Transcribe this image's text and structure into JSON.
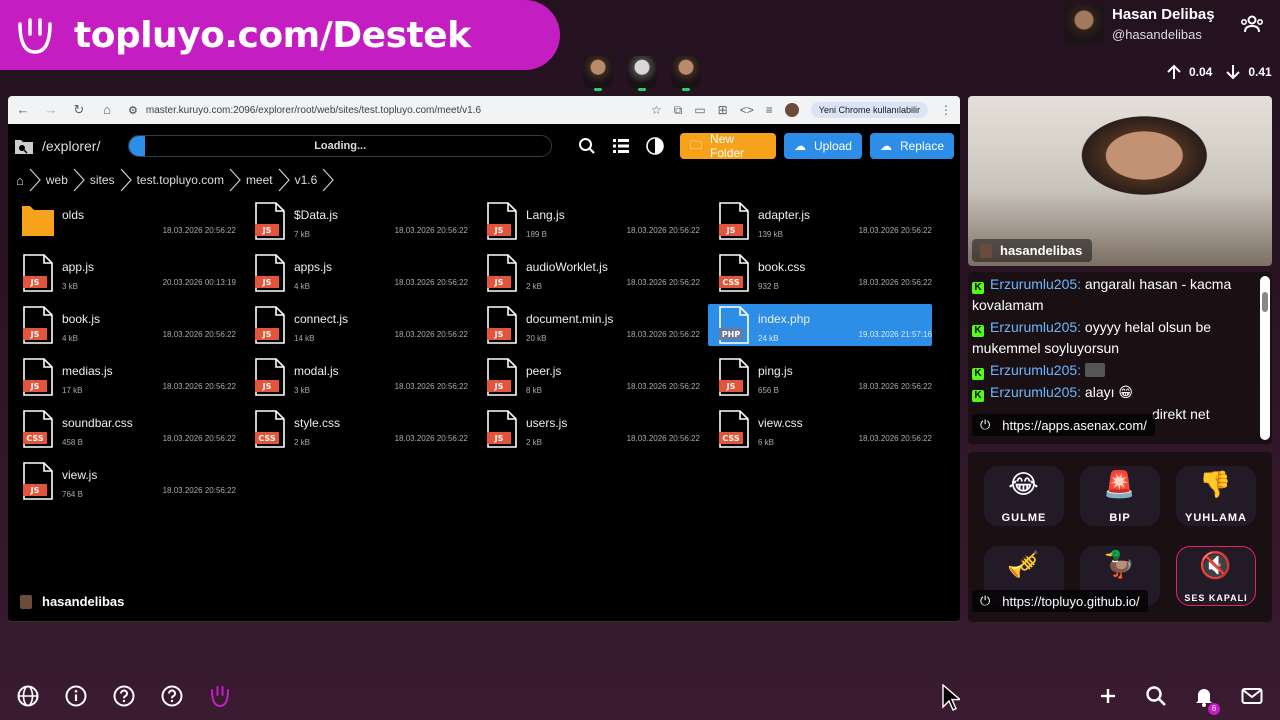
{
  "banner": {
    "text": "topluyo.com/Destek"
  },
  "profile": {
    "name": "Hasan Delibaş",
    "handle": "@hasandelibas"
  },
  "stats": {
    "up": "0.04",
    "down": "0.41"
  },
  "chrome": {
    "url": "master.kuruyo.com:2096/explorer/root/web/sites/test.topluyo.com/meet/v1.6",
    "profile_pill": "Yeni Chrome kullanılabilir"
  },
  "explorer": {
    "path_label": "/explorer/",
    "loading_text": "Loading...",
    "new_folder_label": "New Folder",
    "upload_label": "Upload",
    "replace_label": "Replace",
    "breadcrumb": [
      "web",
      "sites",
      "test.topluyo.com",
      "meet",
      "v1.6"
    ],
    "files": [
      {
        "name": "olds",
        "size": "",
        "date": "18.03.2026 20:56:22",
        "type": "folder"
      },
      {
        "name": "$Data.js",
        "size": "7 kB",
        "date": "18.03.2026 20:56:22",
        "type": "JS"
      },
      {
        "name": "Lang.js",
        "size": "189 B",
        "date": "18.03.2026 20:56:22",
        "type": "JS"
      },
      {
        "name": "adapter.js",
        "size": "139 kB",
        "date": "18.03.2026 20:56:22",
        "type": "JS"
      },
      {
        "name": "app.js",
        "size": "3 kB",
        "date": "20.03.2026 00:13:19",
        "type": "JS"
      },
      {
        "name": "apps.js",
        "size": "4 kB",
        "date": "18.03.2026 20:56:22",
        "type": "JS"
      },
      {
        "name": "audioWorklet.js",
        "size": "2 kB",
        "date": "18.03.2026 20:56:22",
        "type": "JS"
      },
      {
        "name": "book.css",
        "size": "932 B",
        "date": "18.03.2026 20:56:22",
        "type": "CSS"
      },
      {
        "name": "book.js",
        "size": "4 kB",
        "date": "18.03.2026 20:56:22",
        "type": "JS"
      },
      {
        "name": "connect.js",
        "size": "14 kB",
        "date": "18.03.2026 20:56:22",
        "type": "JS"
      },
      {
        "name": "document.min.js",
        "size": "20 kB",
        "date": "18.03.2026 20:56:22",
        "type": "JS"
      },
      {
        "name": "index.php",
        "size": "24 kB",
        "date": "19.03.2026 21:57:16",
        "type": "PHP",
        "selected": true
      },
      {
        "name": "medias.js",
        "size": "17 kB",
        "date": "18.03.2026 20:56:22",
        "type": "JS"
      },
      {
        "name": "modal.js",
        "size": "3 kB",
        "date": "18.03.2026 20:56:22",
        "type": "JS"
      },
      {
        "name": "peer.js",
        "size": "8 kB",
        "date": "18.03.2026 20:56:22",
        "type": "JS"
      },
      {
        "name": "ping.js",
        "size": "656 B",
        "date": "18.03.2026 20:56:22",
        "type": "JS"
      },
      {
        "name": "soundbar.css",
        "size": "458 B",
        "date": "18.03.2026 20:56:22",
        "type": "CSS"
      },
      {
        "name": "style.css",
        "size": "2 kB",
        "date": "18.03.2026 20:56:22",
        "type": "CSS"
      },
      {
        "name": "users.js",
        "size": "2 kB",
        "date": "18.03.2026 20:56:22",
        "type": "JS"
      },
      {
        "name": "view.css",
        "size": "6 kB",
        "date": "18.03.2026 20:56:22",
        "type": "CSS"
      },
      {
        "name": "view.js",
        "size": "764 B",
        "date": "18.03.2026 20:56:22",
        "type": "JS"
      }
    ],
    "footer_user": "hasandelibas"
  },
  "webcam": {
    "label": "hasandelibas"
  },
  "chat": {
    "messages": [
      {
        "user": "Erzurumlu205:",
        "text": " angaralı hasan - kacma kovalamam"
      },
      {
        "user": "Erzurumlu205:",
        "text": " oyyyy helal olsun be mukemmel soyluyorsun"
      },
      {
        "user": "Erzurumlu205:",
        "text": ""
      },
      {
        "user": "Erzurumlu205:",
        "text": " alayı 😁"
      },
      {
        "user": "",
        "text": "direkt net"
      }
    ],
    "overlay_url": "https://apps.asenax.com/"
  },
  "sounds": {
    "items": [
      {
        "label": "GULME",
        "emoji": "😂"
      },
      {
        "label": "BIP",
        "emoji": "🚨"
      },
      {
        "label": "YUHLAMA",
        "emoji": "👎"
      },
      {
        "label": "",
        "emoji": "🎺"
      },
      {
        "label": "",
        "emoji": "🦆"
      },
      {
        "label": "SES KAPALI",
        "emoji": "🔇"
      }
    ],
    "overlay_url": "https://topluyo.github.io/"
  },
  "notifications": {
    "count": "6"
  },
  "colors": {
    "brand": "#c41ec2",
    "accent_blue": "#2d8ee8",
    "folder_orange": "#f7a21b",
    "js_red": "#e2553b"
  }
}
